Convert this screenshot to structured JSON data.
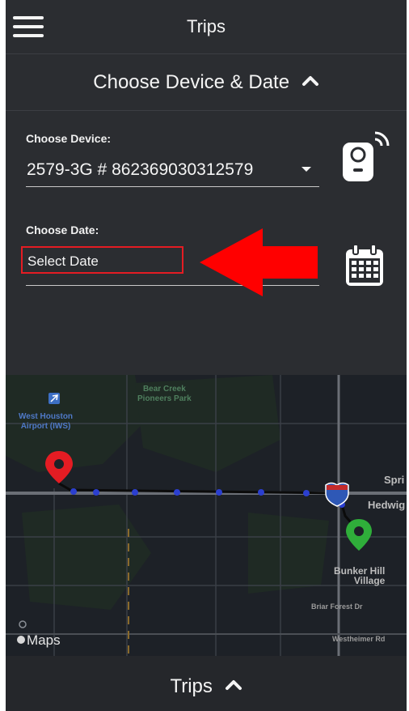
{
  "header": {
    "title": "Trips",
    "menu_icon": "hamburger-icon"
  },
  "section": {
    "label": "Choose Device & Date",
    "expand_icon": "chevron-up-icon"
  },
  "device": {
    "label": "Choose Device:",
    "value": "2579-3G # 862369030312579",
    "icon": "tracker-device-icon"
  },
  "date": {
    "label": "Choose Date:",
    "placeholder": "Select Date",
    "icon": "calendar-icon"
  },
  "map": {
    "places": {
      "park": "Bear Creek\nPioneers Park",
      "airport": "West Houston\nAirport (IWS)",
      "spring": "Spri",
      "hedwig": "Hedwig",
      "bunker": "Bunker Hill\nVillage",
      "briar": "Briar Forest Dr",
      "westheimer": "Westheimer Rd"
    },
    "attribution": "Maps",
    "route": {
      "color": "#0b0b0b",
      "dot_color": "#2b3fd0",
      "start_pin_color": "#e41c23",
      "end_pin_color": "#2fae3a"
    }
  },
  "footer": {
    "label": "Trips",
    "expand_icon": "chevron-up-icon"
  },
  "annotation": {
    "arrow_color": "#ff0000"
  }
}
